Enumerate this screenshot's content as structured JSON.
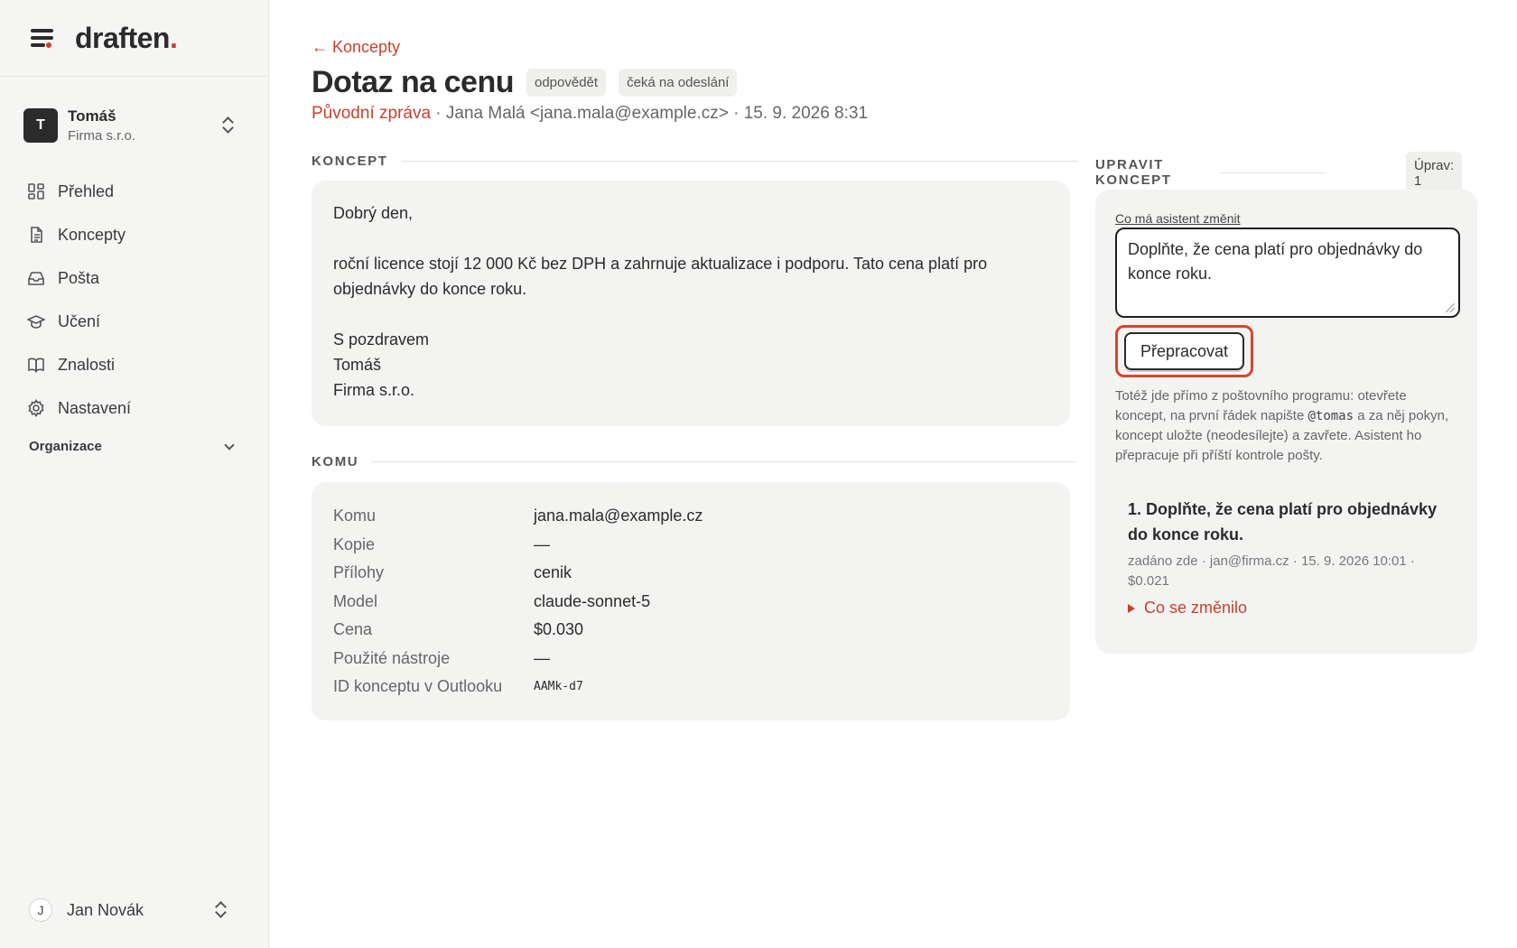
{
  "brand": {
    "name": "draften",
    "dot": "."
  },
  "account": {
    "initial": "T",
    "name": "Tomáš",
    "org": "Firma s.r.o."
  },
  "nav": [
    {
      "label": "Přehled",
      "icon": "grid-icon"
    },
    {
      "label": "Koncepty",
      "icon": "document-icon"
    },
    {
      "label": "Pošta",
      "icon": "inbox-icon"
    },
    {
      "label": "Učení",
      "icon": "graduation-cap-icon"
    },
    {
      "label": "Znalosti",
      "icon": "book-icon"
    },
    {
      "label": "Nastavení",
      "icon": "gear-icon"
    }
  ],
  "organization": {
    "label": "Organizace"
  },
  "user": {
    "initial": "J",
    "name": "Jan Novák"
  },
  "header": {
    "back_label": "← Koncepty",
    "title": "Dotaz na cenu",
    "tags": [
      "odpovědět",
      "čeká na odeslání"
    ],
    "original_label": "Původní zpráva",
    "original_meta": " · Jana Malá <jana.mala@example.cz> · 15. 9. 2026 8:31"
  },
  "draft": {
    "section_label": "KONCEPT",
    "greeting": "Dobrý den,",
    "body": "roční licence stojí 12 000 Kč bez DPH a zahrnuje aktualizace i podporu. Tato cena platí pro objednávky do konce roku.",
    "closing": "S pozdravem",
    "signature_name": "Tomáš",
    "signature_org": "Firma s.r.o."
  },
  "recipients": {
    "section_label": "KOMU",
    "rows": [
      {
        "key": "Komu",
        "value": "jana.mala@example.cz"
      },
      {
        "key": "Kopie",
        "value": "—"
      },
      {
        "key": "Přílohy",
        "value": "cenik"
      },
      {
        "key": "Model",
        "value": "claude-sonnet-5"
      },
      {
        "key": "Cena",
        "value": "$0.030"
      },
      {
        "key": "Použité nástroje",
        "value": "—"
      },
      {
        "key": "ID konceptu v Outlooku",
        "value": "AAMk-d7"
      }
    ]
  },
  "edit": {
    "section_label": "UPRAVIT KONCEPT",
    "count": "Úprav: 1",
    "field_label": "Co má asistent změnit",
    "field_value": "Doplňte, že cena platí pro objednávky do konce roku.",
    "submit_label": "Přepracovat",
    "help_before": "Totéž jde přímo z poštovního programu: otevřete koncept, na první řádek napište ",
    "help_code": "@tomas",
    "help_after": " a za něj pokyn, koncept uložte (neodesílejte) a zavřete. Asistent ho přepracuje při příští kontrole pošty.",
    "history": [
      {
        "title": "1. Doplňte, že cena platí pro objednávky do konce roku.",
        "meta": "zadáno zde · jan@firma.cz · 15. 9. 2026 10:01 · $0.021",
        "changes_label": "Co se změnilo"
      }
    ]
  },
  "colors": {
    "accent": "#c8412b",
    "highlight": "#d9452c",
    "card": "#f3f3f2",
    "sidebar": "#f5f5f4"
  }
}
